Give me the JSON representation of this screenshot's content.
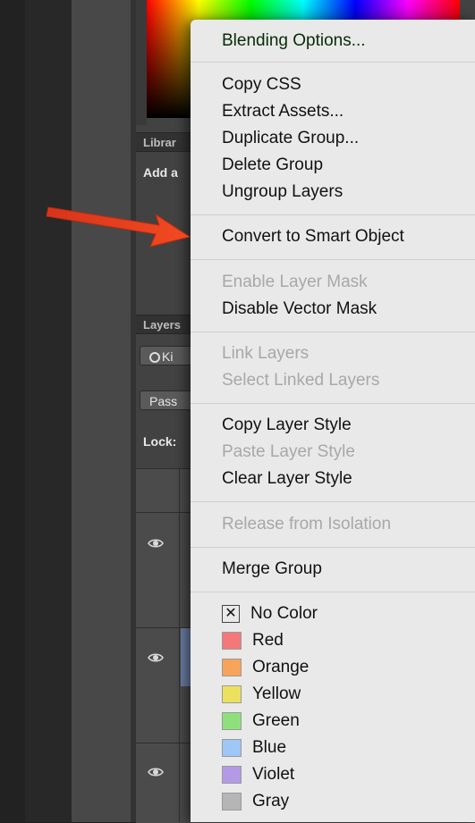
{
  "background_panel": {
    "libraries_header": "Librar",
    "libraries_text": "Add a",
    "layers_header": "Layers",
    "kind_button": "Ki",
    "blend_mode": "Pass",
    "lock_label": "Lock:"
  },
  "context_menu": {
    "blending_options": "Blending Options...",
    "copy_css": "Copy CSS",
    "extract_assets": "Extract Assets...",
    "duplicate_group": "Duplicate Group...",
    "delete_group": "Delete Group",
    "ungroup_layers": "Ungroup Layers",
    "convert_smart_object": "Convert to Smart Object",
    "enable_layer_mask": "Enable Layer Mask",
    "disable_vector_mask": "Disable Vector Mask",
    "link_layers": "Link Layers",
    "select_linked_layers": "Select Linked Layers",
    "copy_layer_style": "Copy Layer Style",
    "paste_layer_style": "Paste Layer Style",
    "clear_layer_style": "Clear Layer Style",
    "release_isolation": "Release from Isolation",
    "merge_group": "Merge Group",
    "colors": [
      {
        "label": "No Color",
        "color": "none"
      },
      {
        "label": "Red",
        "color": "#f4777a"
      },
      {
        "label": "Orange",
        "color": "#f8a35a"
      },
      {
        "label": "Yellow",
        "color": "#ece15f"
      },
      {
        "label": "Green",
        "color": "#8fe07c"
      },
      {
        "label": "Blue",
        "color": "#9ec6f6"
      },
      {
        "label": "Violet",
        "color": "#b39ae6"
      },
      {
        "label": "Gray",
        "color": "#b5b5b5"
      }
    ]
  },
  "accent_colors": {
    "arrow": "#e8401c",
    "menu_background": "#e9e9e9"
  }
}
